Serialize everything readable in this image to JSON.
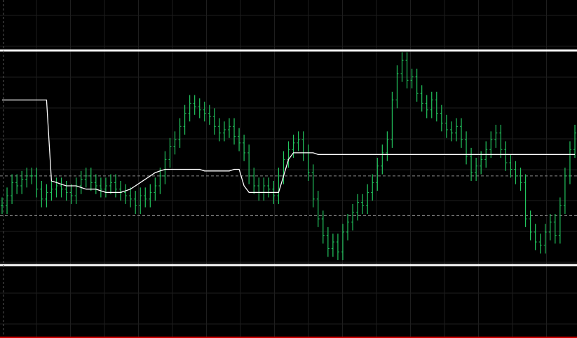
{
  "chart_data": {
    "type": "line",
    "title": "",
    "xlabel": "",
    "ylabel": "",
    "grid": true,
    "colors": {
      "background": "#000000",
      "grid": "#1e1e1e",
      "price": "#22c55e",
      "average": "#ffffff",
      "band": "#ffffff",
      "reference": "#8a8a8a",
      "bottom_border": "#cc0000"
    },
    "y_scale": [
      0,
      100
    ],
    "upper_band": 85,
    "lower_band": 20,
    "reference_levels": [
      47,
      35
    ],
    "series": [
      {
        "kind": "price-bars",
        "values": [
          38,
          41,
          45,
          44,
          46,
          47,
          47,
          43,
          40,
          42,
          43,
          44,
          43,
          42,
          41,
          44,
          46,
          47,
          45,
          44,
          43,
          44,
          45,
          43,
          42,
          41,
          40,
          38,
          41,
          40,
          42,
          44,
          47,
          52,
          56,
          58,
          62,
          66,
          69,
          68,
          67,
          66,
          65,
          62,
          60,
          61,
          62,
          59,
          57,
          54,
          47,
          44,
          42,
          44,
          43,
          41,
          47,
          52,
          55,
          57,
          58,
          54,
          48,
          40,
          34,
          29,
          25,
          27,
          24,
          30,
          33,
          36,
          39,
          38,
          42,
          45,
          50,
          54,
          58,
          70,
          78,
          82,
          76,
          77,
          72,
          69,
          67,
          70,
          66,
          63,
          61,
          60,
          62,
          58,
          53,
          48,
          50,
          52,
          55,
          58,
          60,
          55,
          51,
          49,
          47,
          45,
          34,
          30,
          27,
          26,
          30,
          33,
          29,
          38,
          47,
          55,
          60
        ]
      },
      {
        "kind": "moving-average",
        "values": [
          70,
          70,
          70,
          70,
          70,
          70,
          70,
          70,
          70,
          70,
          45.5,
          45,
          44.5,
          44,
          44,
          44,
          43.5,
          43,
          43,
          43,
          42.5,
          42,
          42,
          42,
          42,
          42.5,
          43,
          44,
          45,
          46,
          47,
          48,
          48.5,
          49,
          49,
          49,
          49,
          49,
          49,
          49,
          49,
          48.5,
          48.5,
          48.5,
          48.5,
          48.5,
          48.5,
          49,
          49,
          44,
          42,
          42,
          42,
          42,
          42,
          42,
          42,
          47,
          52,
          54,
          54,
          54,
          54,
          54,
          53.5,
          53.5,
          53.5,
          53.5,
          53.5,
          53.5,
          53.5,
          53.5,
          53.5,
          53.5,
          53.5,
          53.5,
          53.5,
          53.5,
          53.5,
          53.5,
          53.5,
          53.5,
          53.5,
          53.5,
          53.5,
          53.5,
          53.5,
          53.5,
          53.5,
          53.5,
          53.5,
          53.5,
          53.5,
          53.5,
          53.5,
          53.5,
          53.5,
          53.5,
          53.5,
          53.5,
          53.5,
          53.5,
          53.5,
          53.5,
          53.5,
          53.5,
          53.5,
          53.5,
          53.5,
          53.5,
          53.5,
          53.5,
          53.5,
          53.5,
          53.5,
          53.5,
          53.5
        ]
      }
    ]
  }
}
